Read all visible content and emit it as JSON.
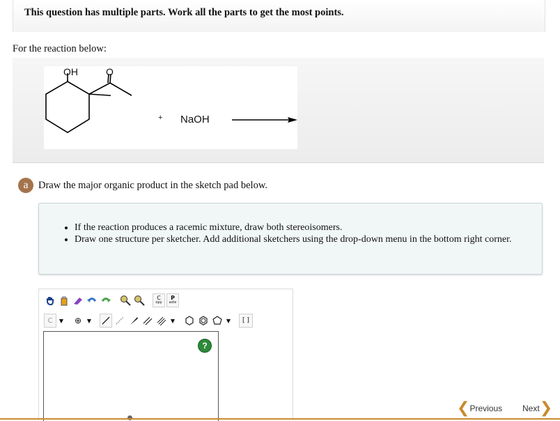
{
  "header": {
    "notice": "This question has multiple parts. Work all the parts to get the most points."
  },
  "question": {
    "intro": "For the reaction below:",
    "reaction": {
      "label_oh": "OH",
      "label_o": "O",
      "plus": "+",
      "reagent": "NaOH"
    }
  },
  "part": {
    "badge": "a",
    "instruction": "Draw the major organic product in the sketch pad below.",
    "hints": [
      "If the reaction produces a racemic mixture, draw both stereoisomers.",
      "Draw one structure per sketcher. Add additional sketchers using the drop-down menu in the bottom right corner."
    ]
  },
  "sketcher": {
    "toolbar": {
      "copy_label_top": "C",
      "copy_label_bottom": "opy",
      "paste_label_top": "P",
      "paste_label_bottom": "aste",
      "element_label": "C",
      "bracket_label": "[ ]",
      "help_label": "?"
    }
  },
  "navigation": {
    "previous": "Previous",
    "next": "Next"
  },
  "colors": {
    "badge": "#a4744c",
    "accent": "#c98a2e",
    "help": "#2d8a3a"
  }
}
